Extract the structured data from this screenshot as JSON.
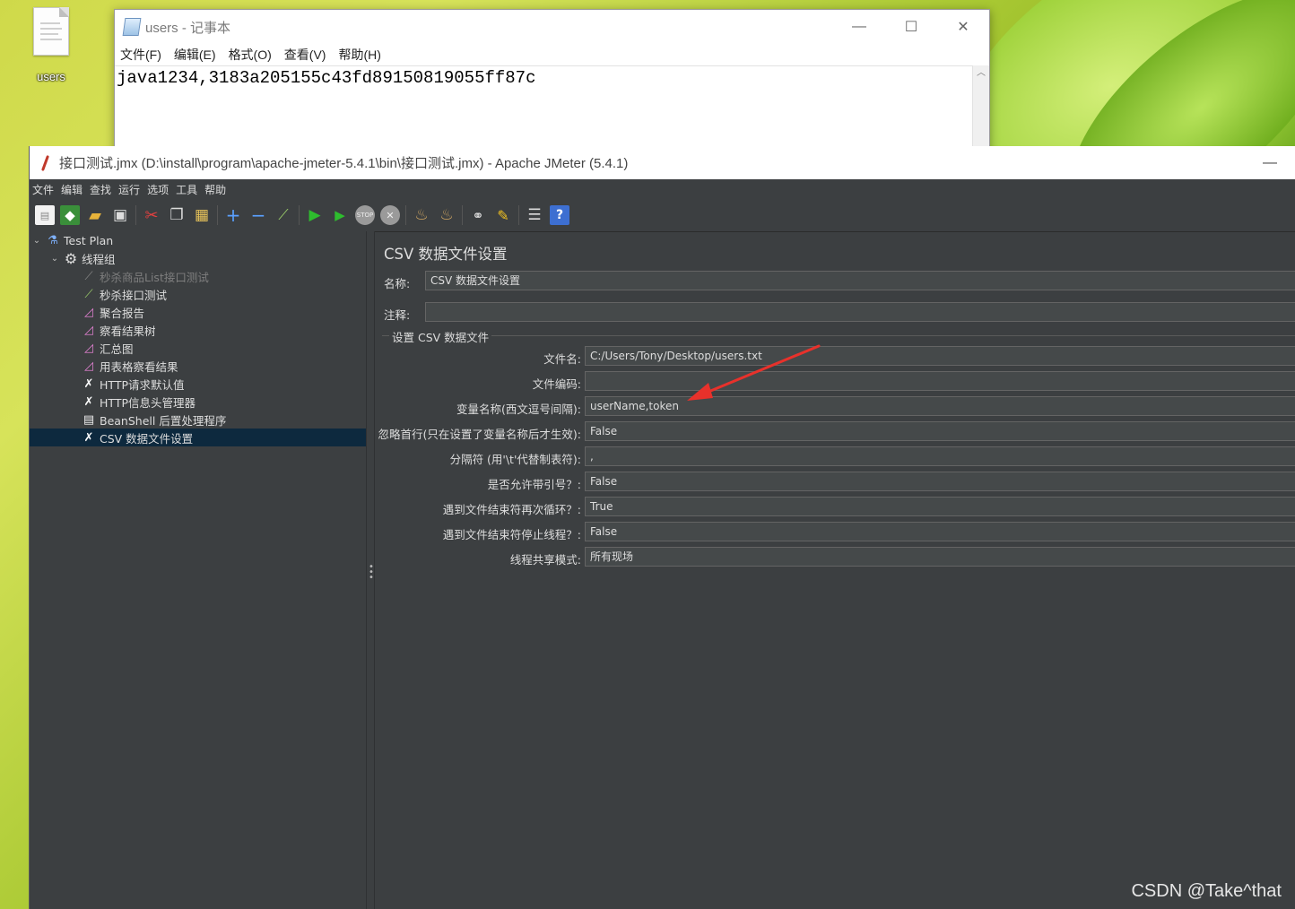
{
  "desktop": {
    "icon_label": "users"
  },
  "notepad": {
    "title": "users - 记事本",
    "menu": [
      "文件(F)",
      "编辑(E)",
      "格式(O)",
      "查看(V)",
      "帮助(H)"
    ],
    "content": "java1234,3183a205155c43fd89150819055ff87c"
  },
  "jmeter": {
    "title": "接口测试.jmx (D:\\install\\program\\apache-jmeter-5.4.1\\bin\\接口测试.jmx) - Apache JMeter (5.4.1)",
    "menu": [
      "文件",
      "编辑",
      "查找",
      "运行",
      "选项",
      "工具",
      "帮助"
    ],
    "toolbar_icons": [
      "new-icon",
      "templates-icon",
      "open-icon",
      "save-icon",
      "cut-icon",
      "copy-icon",
      "paste-icon",
      "expand-icon",
      "collapse-icon",
      "toggle-icon",
      "start-icon",
      "start-no-pause-icon",
      "stop-icon",
      "shutdown-icon",
      "clear-icon",
      "clear-all-icon",
      "search-icon",
      "reset-search-icon",
      "function-helper-icon",
      "help-icon"
    ],
    "tree": [
      {
        "label": "Test Plan",
        "icon": "test-plan-icon",
        "expanded": true,
        "enabled": true
      },
      {
        "label": "线程组",
        "icon": "gear-icon",
        "expanded": true,
        "enabled": true
      },
      {
        "label": "秒杀商品List接口测试",
        "icon": "sampler-icon",
        "enabled": false
      },
      {
        "label": "秒杀接口测试",
        "icon": "sampler-icon",
        "enabled": true
      },
      {
        "label": "聚合报告",
        "icon": "listener-icon",
        "enabled": true
      },
      {
        "label": "察看结果树",
        "icon": "listener-icon",
        "enabled": true
      },
      {
        "label": "汇总图",
        "icon": "listener-icon",
        "enabled": true
      },
      {
        "label": "用表格察看结果",
        "icon": "listener-icon",
        "enabled": true
      },
      {
        "label": "HTTP请求默认值",
        "icon": "config-icon",
        "enabled": true
      },
      {
        "label": "HTTP信息头管理器",
        "icon": "config-icon",
        "enabled": true
      },
      {
        "label": "BeanShell 后置处理程序",
        "icon": "postprocessor-icon",
        "enabled": true
      },
      {
        "label": "CSV 数据文件设置",
        "icon": "config-icon",
        "enabled": true,
        "selected": true
      }
    ],
    "panel": {
      "title": "CSV 数据文件设置",
      "name_label": "名称:",
      "name_value": "CSV 数据文件设置",
      "comment_label": "注释:",
      "comment_value": "",
      "group_title": "设置 CSV 数据文件",
      "fields": [
        {
          "label": "文件名:",
          "value": "C:/Users/Tony/Desktop/users.txt"
        },
        {
          "label": "文件编码:",
          "value": ""
        },
        {
          "label": "变量名称(西文逗号间隔):",
          "value": "userName,token"
        },
        {
          "label": "忽略首行(只在设置了变量名称后才生效):",
          "value": "False"
        },
        {
          "label": "分隔符 (用'\\t'代替制表符):",
          "value": ","
        },
        {
          "label": "是否允许带引号？:",
          "value": "False"
        },
        {
          "label": "遇到文件结束符再次循环？:",
          "value": "True"
        },
        {
          "label": "遇到文件结束符停止线程？:",
          "value": "False"
        },
        {
          "label": "线程共享模式:",
          "value": "所有现场"
        }
      ]
    }
  },
  "watermark": "CSDN @Take^that",
  "colors": {
    "annotation_arrow": "#e8312b",
    "selection": "#0d293e",
    "panel_bg": "#3c3f41"
  }
}
